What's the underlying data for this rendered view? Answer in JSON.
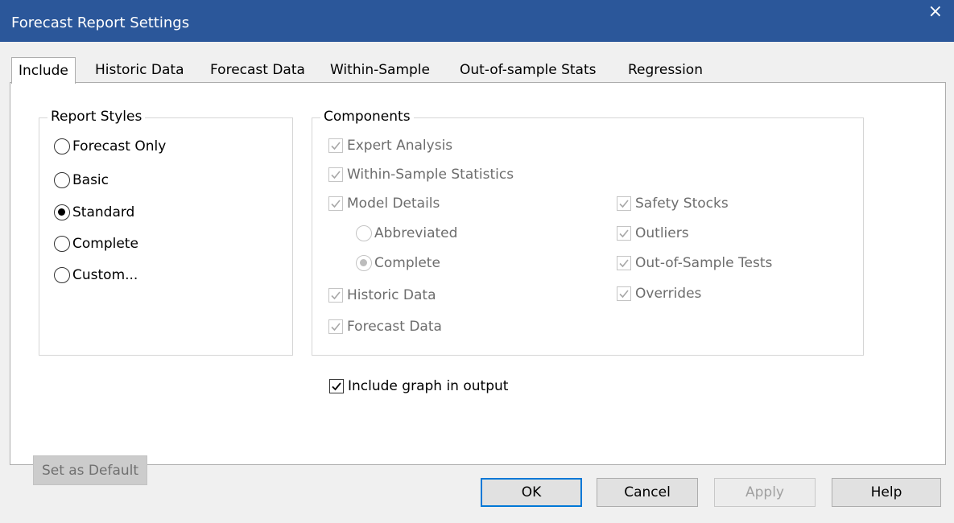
{
  "window": {
    "title": "Forecast Report Settings",
    "close_glyph": "×"
  },
  "tabs": [
    {
      "label": "Include",
      "active": true
    },
    {
      "label": "Historic Data",
      "active": false
    },
    {
      "label": "Forecast Data",
      "active": false
    },
    {
      "label": "Within-Sample",
      "active": false
    },
    {
      "label": "Out-of-sample Stats",
      "active": false
    },
    {
      "label": "Regression",
      "active": false
    }
  ],
  "report_styles": {
    "legend": "Report Styles",
    "options": [
      {
        "label": "Forecast Only",
        "checked": false
      },
      {
        "label": "Basic",
        "checked": false
      },
      {
        "label": "Standard",
        "checked": true
      },
      {
        "label": "Complete",
        "checked": false
      },
      {
        "label": "Custom...",
        "checked": false
      }
    ]
  },
  "components": {
    "legend": "Components",
    "left": [
      {
        "label": "Expert Analysis",
        "checked": true,
        "enabled": false
      },
      {
        "label": "Within-Sample Statistics",
        "checked": true,
        "enabled": false
      },
      {
        "label": "Model Details",
        "checked": true,
        "enabled": false
      },
      {
        "label": "Historic Data",
        "checked": true,
        "enabled": false
      },
      {
        "label": "Forecast Data",
        "checked": true,
        "enabled": false
      }
    ],
    "model_detail_options": [
      {
        "label": "Abbreviated",
        "checked": false,
        "enabled": false
      },
      {
        "label": "Complete",
        "checked": true,
        "enabled": false
      }
    ],
    "right": [
      {
        "label": "Safety Stocks",
        "checked": true,
        "enabled": false
      },
      {
        "label": "Outliers",
        "checked": true,
        "enabled": false
      },
      {
        "label": "Out-of-Sample Tests",
        "checked": true,
        "enabled": false
      },
      {
        "label": "Overrides",
        "checked": true,
        "enabled": false
      }
    ]
  },
  "include_graph": {
    "label": "Include graph in output",
    "checked": true
  },
  "set_default_label": "Set as Default",
  "buttons": {
    "ok": "OK",
    "cancel": "Cancel",
    "apply": "Apply",
    "help": "Help"
  },
  "colors": {
    "titlebar": "#2b579a",
    "focus_border": "#0078d7",
    "disabled_text": "#6d6d6d"
  }
}
